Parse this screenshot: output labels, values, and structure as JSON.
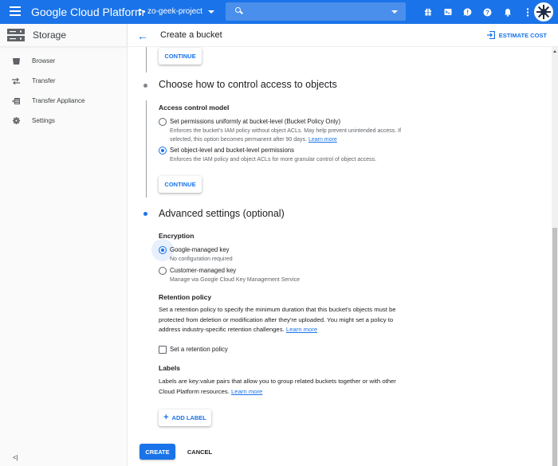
{
  "topbar": {
    "brand": "Google Cloud Platform",
    "project": "zo-geek-project",
    "search_placeholder": "",
    "icons": [
      "gift-icon",
      "cloud-shell-icon",
      "feedback-icon",
      "help-icon",
      "notifications-icon",
      "more-vert-icon"
    ]
  },
  "sidebar": {
    "title": "Storage",
    "items": [
      {
        "label": "Browser",
        "icon": "bucket-icon"
      },
      {
        "label": "Transfer",
        "icon": "transfer-icon"
      },
      {
        "label": "Transfer Appliance",
        "icon": "transfer-appliance-icon"
      },
      {
        "label": "Settings",
        "icon": "gear-icon"
      }
    ],
    "collapse_glyph": "<|"
  },
  "header": {
    "title": "Create a bucket",
    "estimate_cost": "ESTIMATE COST"
  },
  "steps": {
    "continue_top": "CONTINUE",
    "access": {
      "title": "Choose how to control access to objects",
      "subtitle": "Access control model",
      "options": [
        {
          "label": "Set permissions uniformly at bucket-level (Bucket Policy Only)",
          "desc": "Enforces the bucket's IAM policy without object ACLs. May help prevent unintended access. If selected, this option becomes permanent after 90 days.",
          "link": "Learn more",
          "selected": false
        },
        {
          "label": "Set object-level and bucket-level permissions",
          "desc": "Enforces the IAM policy and object ACLs for more granular control of object access.",
          "selected": true
        }
      ],
      "continue": "CONTINUE"
    },
    "advanced": {
      "title": "Advanced settings (optional)",
      "encryption": {
        "title": "Encryption",
        "options": [
          {
            "label": "Google-managed key",
            "desc": "No configuration required",
            "selected": true
          },
          {
            "label": "Customer-managed key",
            "desc": "Manage via Google Cloud Key Management Service",
            "selected": false
          }
        ]
      },
      "retention": {
        "title": "Retention policy",
        "desc": "Set a retention policy to specify the minimum duration that this bucket's objects must be protected from deletion or modification after they're uploaded. You might set a policy to address industry-specific retention challenges.",
        "link": "Learn more",
        "checkbox_label": "Set a retention policy",
        "checked": false
      },
      "labels": {
        "title": "Labels",
        "desc": "Labels are key:value pairs that allow you to group related buckets together or with other Cloud Platform resources.",
        "link": "Learn more",
        "add_label": "ADD LABEL"
      }
    }
  },
  "footer": {
    "create": "CREATE",
    "cancel": "CANCEL"
  },
  "colors": {
    "accent": "#1a73e8",
    "topbar": "#1a73e8"
  }
}
